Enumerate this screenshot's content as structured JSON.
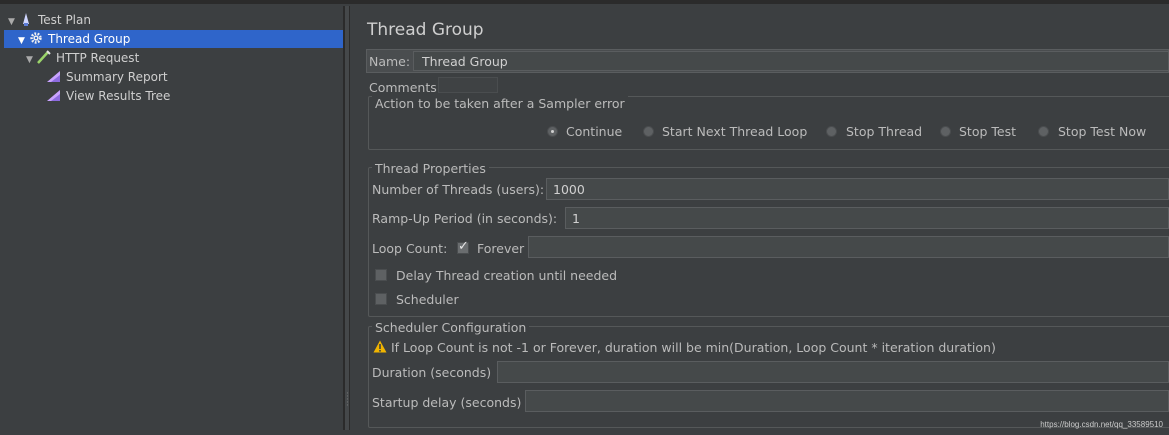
{
  "tree": {
    "items": [
      {
        "label": "Test Plan",
        "icon": "test-plan-icon"
      },
      {
        "label": "Thread Group",
        "icon": "gear-icon"
      },
      {
        "label": "HTTP Request",
        "icon": "pipette-icon"
      },
      {
        "label": "Summary Report",
        "icon": "chart-icon"
      },
      {
        "label": "View Results Tree",
        "icon": "chart-icon"
      }
    ]
  },
  "panel": {
    "title": "Thread Group",
    "name_label": "Name:",
    "name_value": "Thread Group",
    "comments_label": "Comments:",
    "sampler_error": {
      "title": "Action to be taken after a Sampler error",
      "options": [
        "Continue",
        "Start Next Thread Loop",
        "Stop Thread",
        "Stop Test",
        "Stop Test Now"
      ],
      "selected": "Continue"
    },
    "thread_props": {
      "title": "Thread Properties",
      "threads_label": "Number of Threads (users):",
      "threads_value": "1000",
      "rampup_label": "Ramp-Up Period (in seconds):",
      "rampup_value": "1",
      "loop_label": "Loop Count:",
      "forever_label": "Forever",
      "forever_checked": true,
      "delay_label": "Delay Thread creation until needed",
      "scheduler_label": "Scheduler"
    },
    "scheduler_config": {
      "title": "Scheduler Configuration",
      "warning": "If Loop Count is not -1 or Forever, duration will be min(Duration, Loop Count * iteration duration)",
      "duration_label": "Duration (seconds)",
      "startup_label": "Startup delay (seconds)"
    }
  },
  "watermark": "https://blog.csdn.net/qq_33589510",
  "colors": {
    "selection": "#2f65ca",
    "background": "#3c3f41",
    "warning": "#f0b400"
  }
}
